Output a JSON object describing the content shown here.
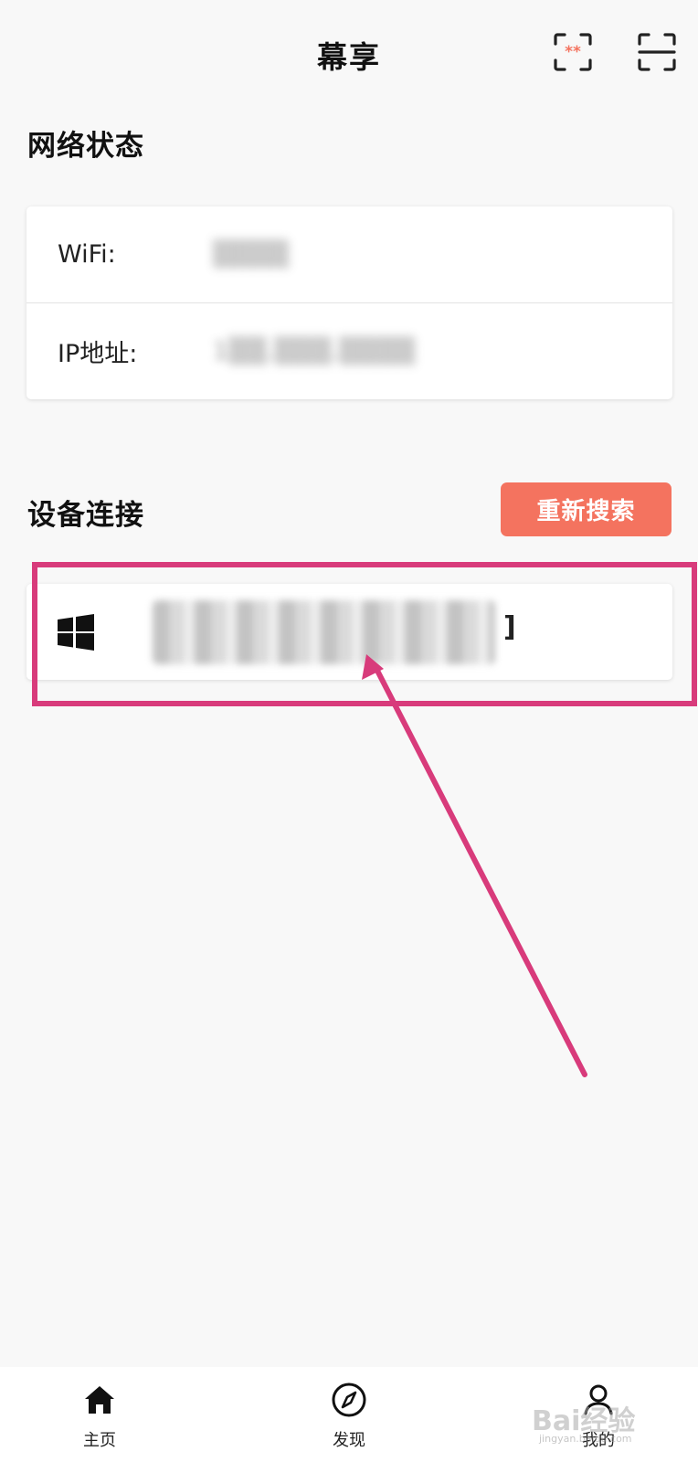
{
  "header": {
    "title": "幕享",
    "cast_icon": "screen-cast-icon",
    "scan_icon": "scan-icon"
  },
  "network": {
    "title": "网络状态",
    "wifi_label": "WiFi:",
    "wifi_value": "▒▒▒▒",
    "ip_label": "IP地址:",
    "ip_value": "1▒▒.▒▒▒.▒▒▒▒"
  },
  "devices": {
    "title": "设备连接",
    "research_button": "重新搜索",
    "items": [
      {
        "icon": "windows-icon",
        "name_tail": "]"
      }
    ]
  },
  "tabbar": {
    "home": "主页",
    "discover": "发现",
    "mine": "我的"
  },
  "watermark": {
    "text": "Bai经验",
    "sub": "jingyan.baidu.com"
  },
  "colors": {
    "accent": "#f4735f",
    "highlight": "#d83b7b",
    "background": "#f8f8f8"
  }
}
